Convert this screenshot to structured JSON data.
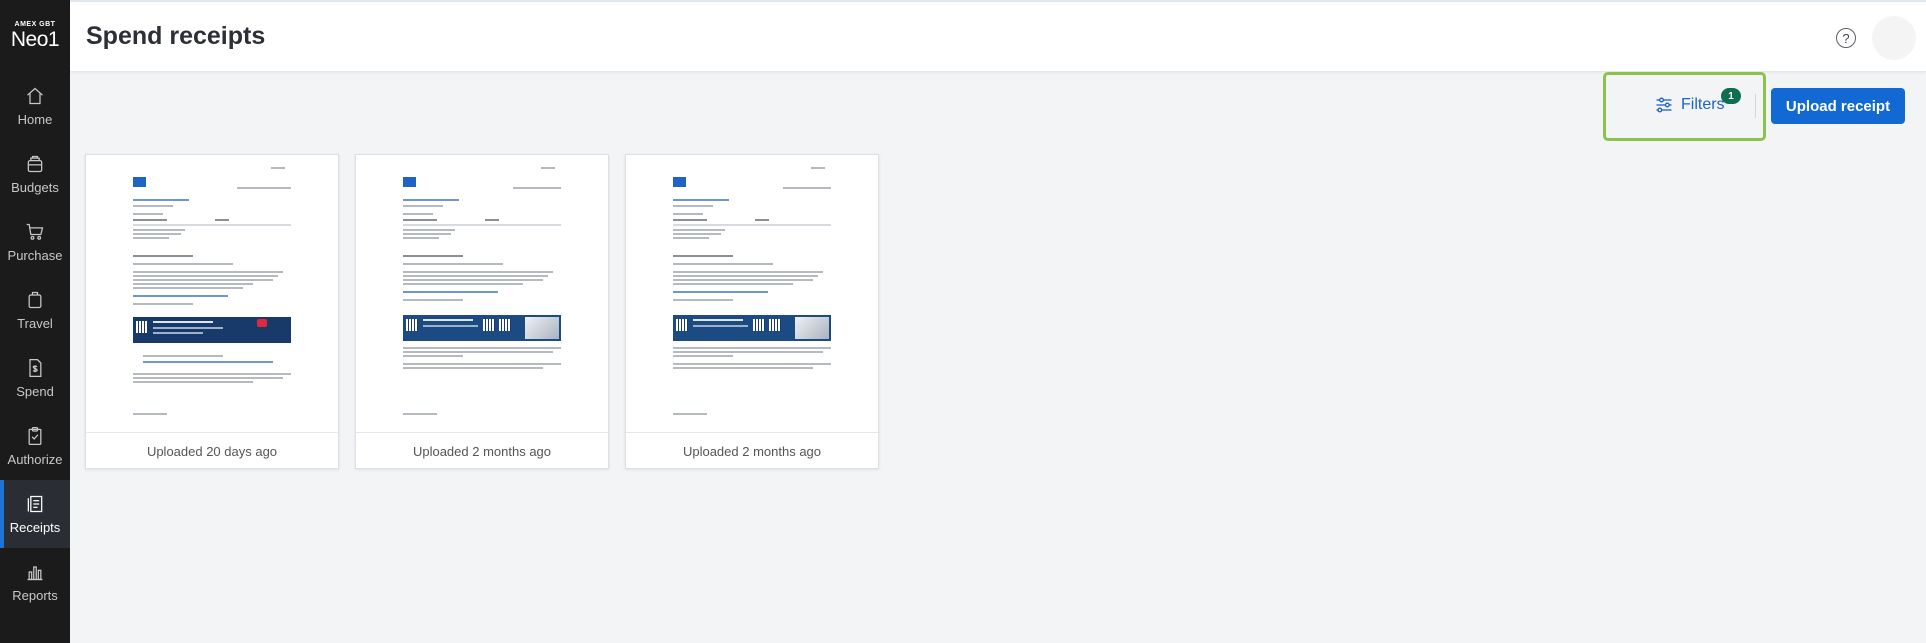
{
  "sidebar": {
    "logo_small": "AMEX GBT",
    "logo_big": "Neo1",
    "items": [
      {
        "label": "Home",
        "icon": "home-icon"
      },
      {
        "label": "Budgets",
        "icon": "budgets-icon"
      },
      {
        "label": "Purchase",
        "icon": "cart-icon"
      },
      {
        "label": "Travel",
        "icon": "luggage-icon"
      },
      {
        "label": "Spend",
        "icon": "spend-icon"
      },
      {
        "label": "Authorize",
        "icon": "clipboard-icon"
      },
      {
        "label": "Receipts",
        "icon": "receipts-icon",
        "active": true
      },
      {
        "label": "Reports",
        "icon": "bar-chart-icon"
      }
    ],
    "active_color": "#1f72d6"
  },
  "header": {
    "title": "Spend receipts",
    "help_glyph": "?"
  },
  "toolbar": {
    "filters_label": "Filters",
    "filters_count": "1",
    "upload_label": "Upload receipt",
    "primary_color": "#1269d3",
    "highlight_color": "#8bc34a"
  },
  "receipts": [
    {
      "caption": "Uploaded 20 days ago",
      "banner": "red-promo"
    },
    {
      "caption": "Uploaded 2 months ago",
      "banner": "photo-promo"
    },
    {
      "caption": "Uploaded 2 months ago",
      "banner": "photo-promo"
    }
  ]
}
